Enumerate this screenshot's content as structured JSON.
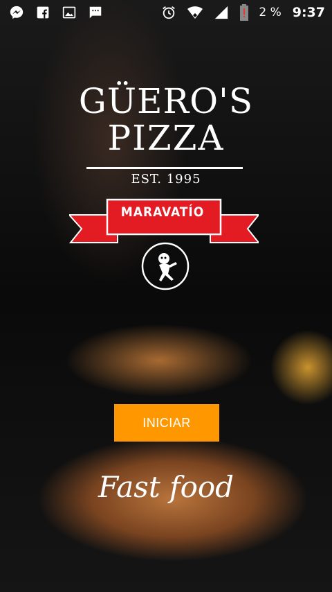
{
  "status_bar": {
    "left_icons": [
      "messenger-icon",
      "facebook-icon",
      "image-icon",
      "sms-icon"
    ],
    "right_icons": [
      "alarm-icon",
      "wifi-icon",
      "signal-icon",
      "battery-alert-icon"
    ],
    "battery_percent": "2 %",
    "time": "9:37"
  },
  "logo": {
    "line1": "GÜERO'S",
    "line2": "PIZZA",
    "established": "EST. 1995",
    "ribbon_text": "MARAVATÍO"
  },
  "button": {
    "label": "INICIAR"
  },
  "tagline": "Fast food",
  "colors": {
    "accent": "#FF9800",
    "ribbon": "#E31B23"
  }
}
